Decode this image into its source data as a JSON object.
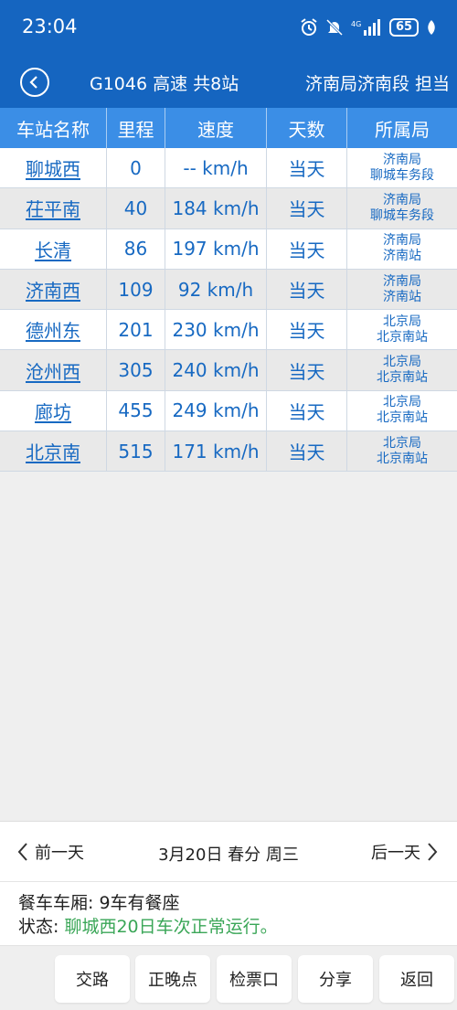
{
  "status_bar": {
    "time": "23:04",
    "network": "4G",
    "battery": "65"
  },
  "header": {
    "train_info": "G1046 高速 共8站",
    "bureau_info": "济南局济南段 担当"
  },
  "table": {
    "columns": [
      "车站名称",
      "里程",
      "速度",
      "天数",
      "所属局"
    ],
    "rows": [
      {
        "station": "聊城西",
        "mileage": "0",
        "speed": "-- km/h",
        "day": "当天",
        "bureau": "济南局",
        "depot": "聊城车务段"
      },
      {
        "station": "茌平南",
        "mileage": "40",
        "speed": "184 km/h",
        "day": "当天",
        "bureau": "济南局",
        "depot": "聊城车务段"
      },
      {
        "station": "长清",
        "mileage": "86",
        "speed": "197 km/h",
        "day": "当天",
        "bureau": "济南局",
        "depot": "济南站"
      },
      {
        "station": "济南西",
        "mileage": "109",
        "speed": "92 km/h",
        "day": "当天",
        "bureau": "济南局",
        "depot": "济南站"
      },
      {
        "station": "德州东",
        "mileage": "201",
        "speed": "230 km/h",
        "day": "当天",
        "bureau": "北京局",
        "depot": "北京南站"
      },
      {
        "station": "沧州西",
        "mileage": "305",
        "speed": "240 km/h",
        "day": "当天",
        "bureau": "北京局",
        "depot": "北京南站"
      },
      {
        "station": "廊坊",
        "mileage": "455",
        "speed": "249 km/h",
        "day": "当天",
        "bureau": "北京局",
        "depot": "北京南站"
      },
      {
        "station": "北京南",
        "mileage": "515",
        "speed": "171 km/h",
        "day": "当天",
        "bureau": "北京局",
        "depot": "北京南站"
      }
    ]
  },
  "day_nav": {
    "prev": "前一天",
    "date": "3月20日 春分 周三",
    "next": "后一天"
  },
  "info": {
    "dining_label": "餐车车厢:",
    "dining_value": " 9车有餐座",
    "status_label": "状态:",
    "status_value": " 聊城西20日车次正常运行。"
  },
  "buttons": [
    "交路",
    "正晚点",
    "检票口",
    "分享",
    "返回"
  ],
  "colors": {
    "primary": "#1565c0",
    "header_blue": "#3b8ee6",
    "link": "#1769c2",
    "status_green": "#3aa657"
  }
}
